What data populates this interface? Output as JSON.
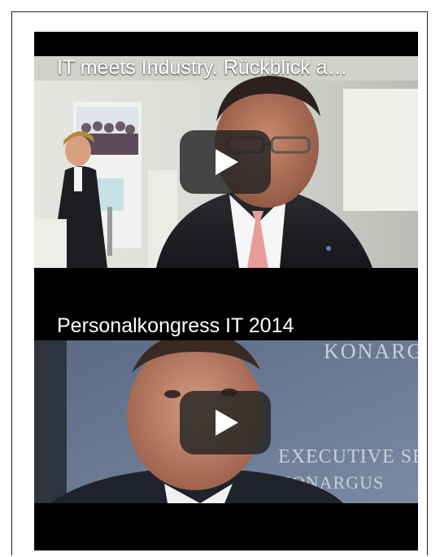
{
  "videos": [
    {
      "title": "IT meets Industry. Rückblick a…",
      "play_icon": "play-icon"
    },
    {
      "title": "Personalkongress IT 2014",
      "play_icon": "play-icon",
      "background_text_line1": "EXECUTIVE SEARCH",
      "background_text_line2": "KONARGUS",
      "background_text_top": "KONARG"
    }
  ],
  "colors": {
    "player_background": "#000000",
    "play_button": "#232323",
    "title_text": "#ffffff"
  }
}
